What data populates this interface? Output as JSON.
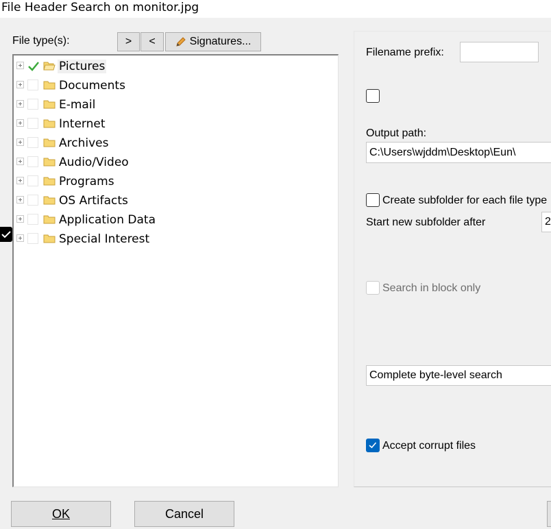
{
  "window": {
    "title": "File Header Search on monitor.jpg"
  },
  "file_types": {
    "label": "File type(s):",
    "add_label": ">",
    "remove_label": "<",
    "signatures_label": "Signatures...",
    "tree": [
      {
        "label": "Pictures",
        "checked": true,
        "selected": true
      },
      {
        "label": "Documents",
        "checked": false
      },
      {
        "label": "E-mail",
        "checked": false
      },
      {
        "label": "Internet",
        "checked": false
      },
      {
        "label": "Archives",
        "checked": false
      },
      {
        "label": "Audio/Video",
        "checked": false
      },
      {
        "label": "Programs",
        "checked": false
      },
      {
        "label": "OS Artifacts",
        "checked": false
      },
      {
        "label": "Application Data",
        "checked": false
      },
      {
        "label": "Special Interest",
        "checked": false
      }
    ]
  },
  "options": {
    "filename_prefix_label": "Filename prefix:",
    "filename_prefix_value": "",
    "unlabeled_checkbox_checked": false,
    "output_path_label": "Output path:",
    "output_path_value": "C:\\Users\\wjddm\\Desktop\\Eun\\",
    "create_subfolder_label": "Create subfolder for each file type",
    "create_subfolder_checked": false,
    "start_subfolder_label": "Start new subfolder after",
    "start_subfolder_value": "2",
    "search_block_label": "Search in block only",
    "search_block_checked": false,
    "search_block_enabled": false,
    "search_mode_value": "Complete byte-level search",
    "accept_corrupt_label": "Accept corrupt files",
    "accept_corrupt_checked": true
  },
  "buttons": {
    "ok_label": "OK",
    "cancel_label": "Cancel"
  },
  "colors": {
    "accent": "#0067c0",
    "check_green": "#3caa3c",
    "folder": "#f7d773"
  }
}
